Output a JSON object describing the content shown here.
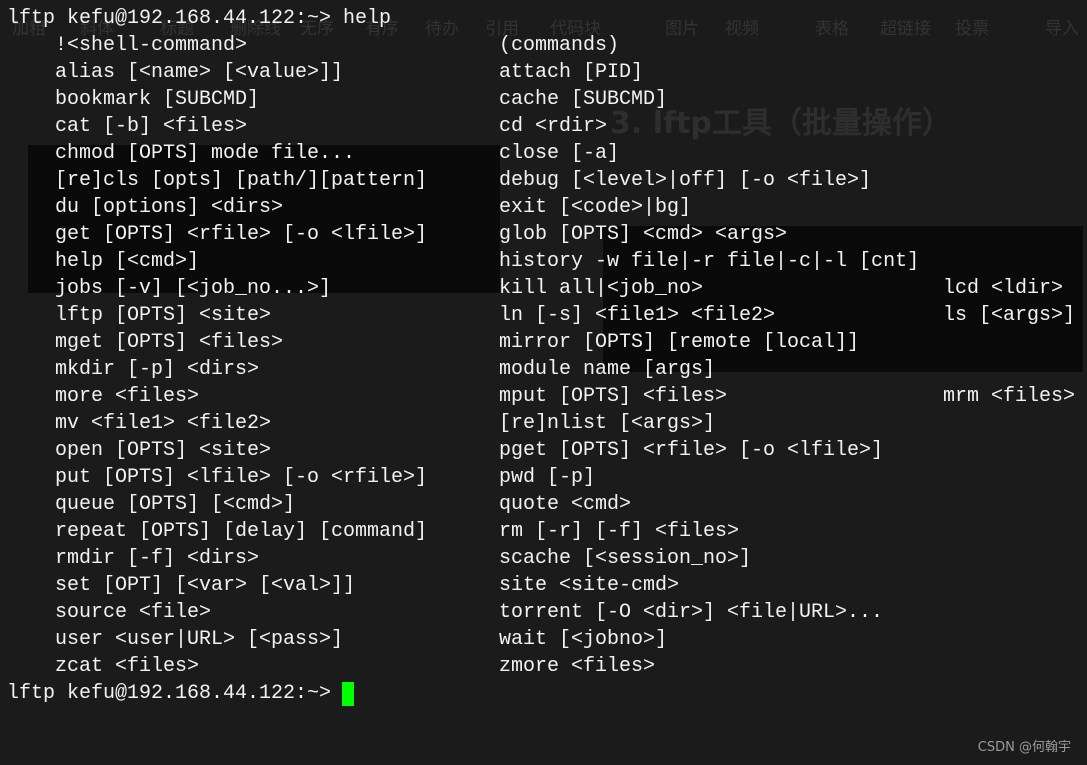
{
  "background_ghost": {
    "toolbar": [
      "加粗",
      "斜体",
      "标题",
      "删除线",
      "无序",
      "有序",
      "待办",
      "引用",
      "代码块",
      "图片",
      "视频",
      "表格",
      "超链接",
      "投票",
      "导入"
    ],
    "heading": "3. lftp工具（批量操作）"
  },
  "terminal": {
    "command_prompt": "lftp kefu@192.168.44.122:~> help",
    "rows": [
      [
        "!<shell-command>",
        "(commands)",
        ""
      ],
      [
        "alias [<name> [<value>]]",
        "attach [PID]",
        ""
      ],
      [
        "bookmark [SUBCMD]",
        "cache [SUBCMD]",
        ""
      ],
      [
        "cat [-b] <files>",
        "cd <rdir>",
        ""
      ],
      [
        "chmod [OPTS] mode file...",
        "close [-a]",
        ""
      ],
      [
        "[re]cls [opts] [path/][pattern]",
        "debug [<level>|off] [-o <file>]",
        ""
      ],
      [
        "du [options] <dirs>",
        "exit [<code>|bg]",
        ""
      ],
      [
        "get [OPTS] <rfile> [-o <lfile>]",
        "glob [OPTS] <cmd> <args>",
        ""
      ],
      [
        "help [<cmd>]",
        "history -w file|-r file|-c|-l [cnt]",
        ""
      ],
      [
        "jobs [-v] [<job_no...>]",
        "kill all|<job_no>",
        "lcd <ldir>"
      ],
      [
        "lftp [OPTS] <site>",
        "ln [-s] <file1> <file2>",
        "ls [<args>]"
      ],
      [
        "mget [OPTS] <files>",
        "mirror [OPTS] [remote [local]]",
        ""
      ],
      [
        "mkdir [-p] <dirs>",
        "module name [args]",
        ""
      ],
      [
        "more <files>",
        "mput [OPTS] <files>",
        "mrm <files>"
      ],
      [
        "mv <file1> <file2>",
        "[re]nlist [<args>]",
        ""
      ],
      [
        "open [OPTS] <site>",
        "pget [OPTS] <rfile> [-o <lfile>]",
        ""
      ],
      [
        "put [OPTS] <lfile> [-o <rfile>]",
        "pwd [-p]",
        ""
      ],
      [
        "queue [OPTS] [<cmd>]",
        "quote <cmd>",
        ""
      ],
      [
        "repeat [OPTS] [delay] [command]",
        "rm [-r] [-f] <files>",
        ""
      ],
      [
        "rmdir [-f] <dirs>",
        "scache [<session_no>]",
        ""
      ],
      [
        "set [OPT] [<var> [<val>]]",
        "site <site-cmd>",
        ""
      ],
      [
        "source <file>",
        "torrent [-O <dir>] <file|URL>...",
        ""
      ],
      [
        "user <user|URL> [<pass>]",
        "wait [<jobno>]",
        ""
      ],
      [
        "zcat <files>",
        "zmore <files>",
        ""
      ]
    ],
    "final_prompt": "lftp kefu@192.168.44.122:~>",
    "cursor_color": "#00ff00"
  },
  "watermark": "CSDN @何翰宇"
}
